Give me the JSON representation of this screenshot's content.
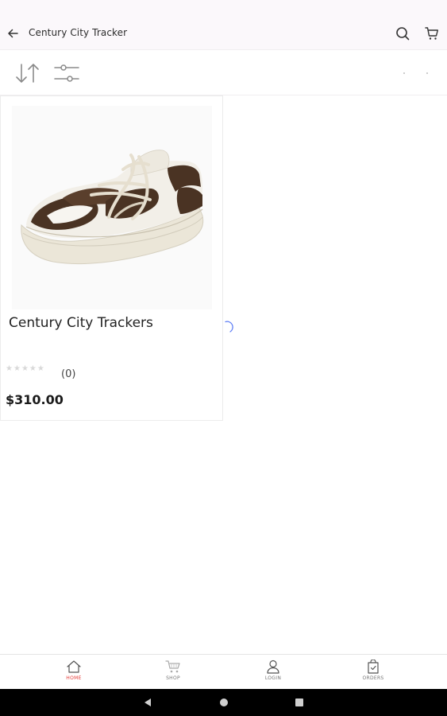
{
  "header": {
    "title": "Century City Tracker",
    "back_icon": "arrow-left-icon",
    "search_icon": "search-icon",
    "cart_icon": "cart-icon"
  },
  "toolbar": {
    "sort_icon": "sort-icon",
    "filter_icon": "filter-icon"
  },
  "products": [
    {
      "name": "Century City Trackers",
      "rating": 0,
      "rating_max": 5,
      "review_count": "(0)",
      "price": "$310.00",
      "image_icon": "sneaker-image"
    }
  ],
  "bottom_nav": {
    "items": [
      {
        "label": "HOME",
        "icon": "home-icon",
        "active": true
      },
      {
        "label": "SHOP",
        "icon": "shop-cart-icon",
        "active": false
      },
      {
        "label": "LOGIN",
        "icon": "user-icon",
        "active": false
      },
      {
        "label": "ORDERS",
        "icon": "orders-bag-icon",
        "active": false
      }
    ]
  },
  "colors": {
    "accent": "#e53935",
    "appbar_bg": "#fbf8fb",
    "icon_gray": "#8a8a8a",
    "spinner": "#5b7cf5"
  }
}
